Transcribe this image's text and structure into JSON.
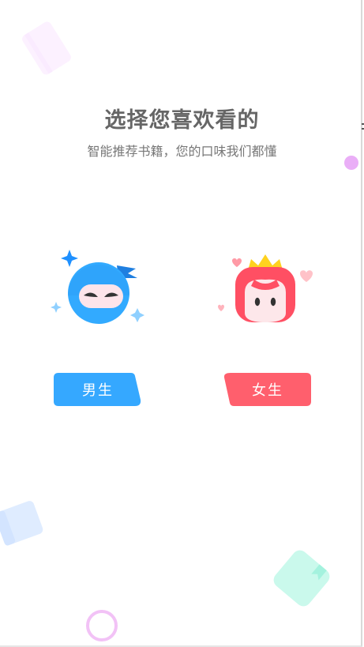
{
  "header": {
    "title": "选择您喜欢看的",
    "subtitle": "智能推荐书籍，您的口味我们都懂"
  },
  "options": {
    "male": {
      "label": "男生",
      "color": "#35a8ff",
      "avatar_icon": "ninja-boy-avatar-icon"
    },
    "female": {
      "label": "女生",
      "color": "#ff5f6d",
      "avatar_icon": "princess-girl-avatar-icon"
    }
  },
  "decorations": {
    "book_pink": "#fbe7ff",
    "book_blue": "#cfe3ff",
    "book_green": "#bdf8e8",
    "dot_purple": "#eaaef7",
    "ring_pink": "#f2c2f6"
  }
}
